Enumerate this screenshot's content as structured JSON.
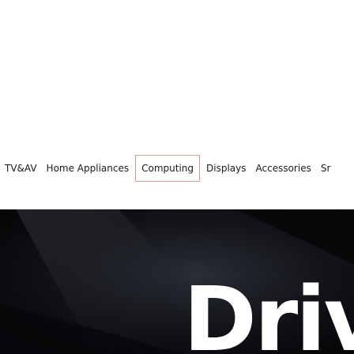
{
  "nav": {
    "items": [
      {
        "label": "TV&AV"
      },
      {
        "label": "Home Appliances"
      },
      {
        "label": "Computing"
      },
      {
        "label": "Displays"
      },
      {
        "label": "Accessories"
      },
      {
        "label": "Sr"
      }
    ],
    "active_index": 2
  },
  "hero": {
    "headline": "Drivo"
  },
  "colors": {
    "active_border": "#d9a0a0",
    "hero_background": "#0a0b10",
    "text": "#1a1a1a"
  }
}
